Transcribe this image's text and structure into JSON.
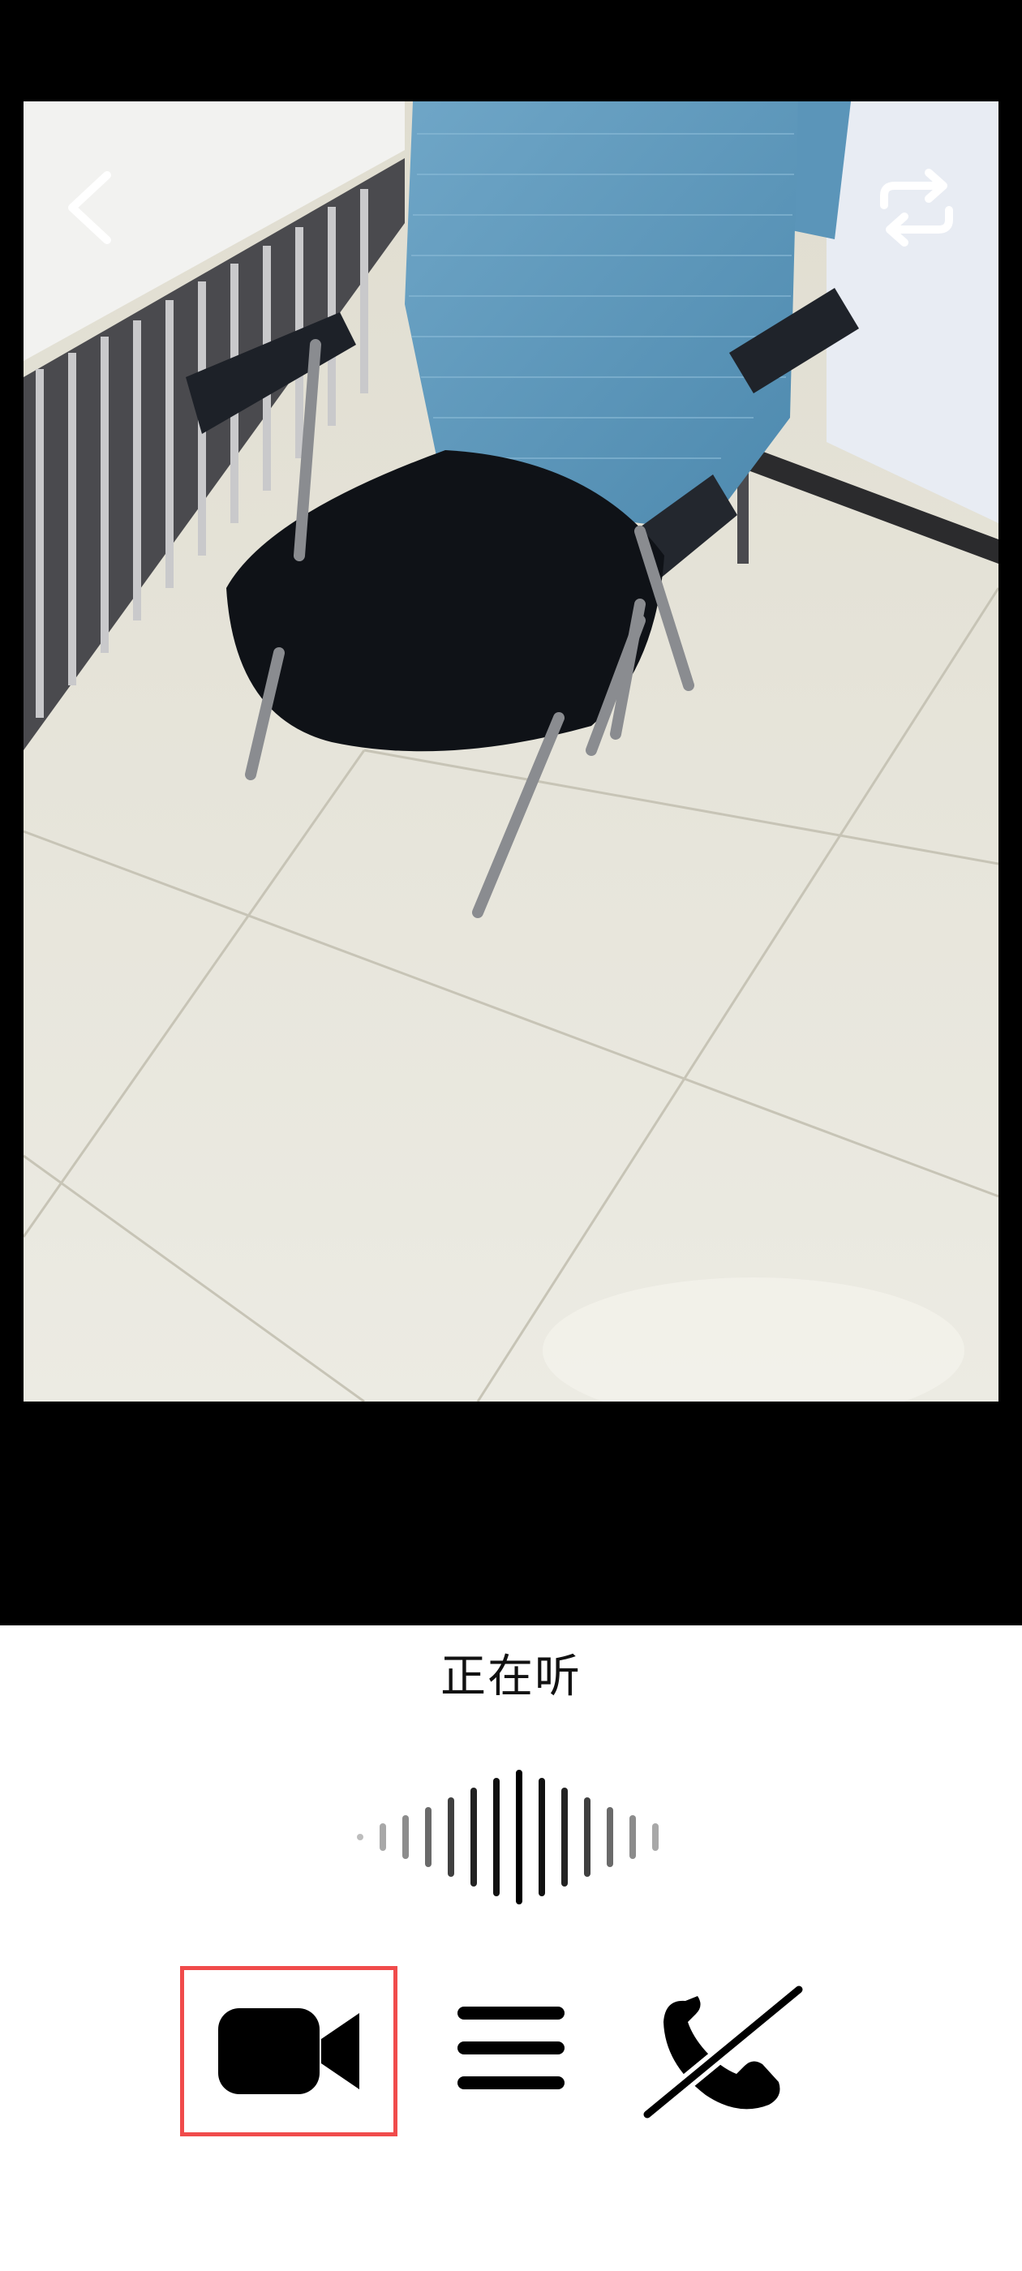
{
  "camera": {
    "scene": "camera-preview"
  },
  "top_bar": {
    "back_icon": "chevron-left-icon",
    "switch_icon": "switch-camera-icon"
  },
  "status": {
    "text": "正在听"
  },
  "waveform": {
    "icon": "audio-waveform-icon"
  },
  "controls": {
    "video_icon": "video-camera-icon",
    "menu_icon": "menu-icon",
    "hangup_icon": "hang-up-icon",
    "highlight_color": "#f04b4b"
  },
  "colors": {
    "background_top": "#000000",
    "background_bottom": "#ffffff",
    "icon_dark": "#000000",
    "icon_light": "#ffffff"
  }
}
